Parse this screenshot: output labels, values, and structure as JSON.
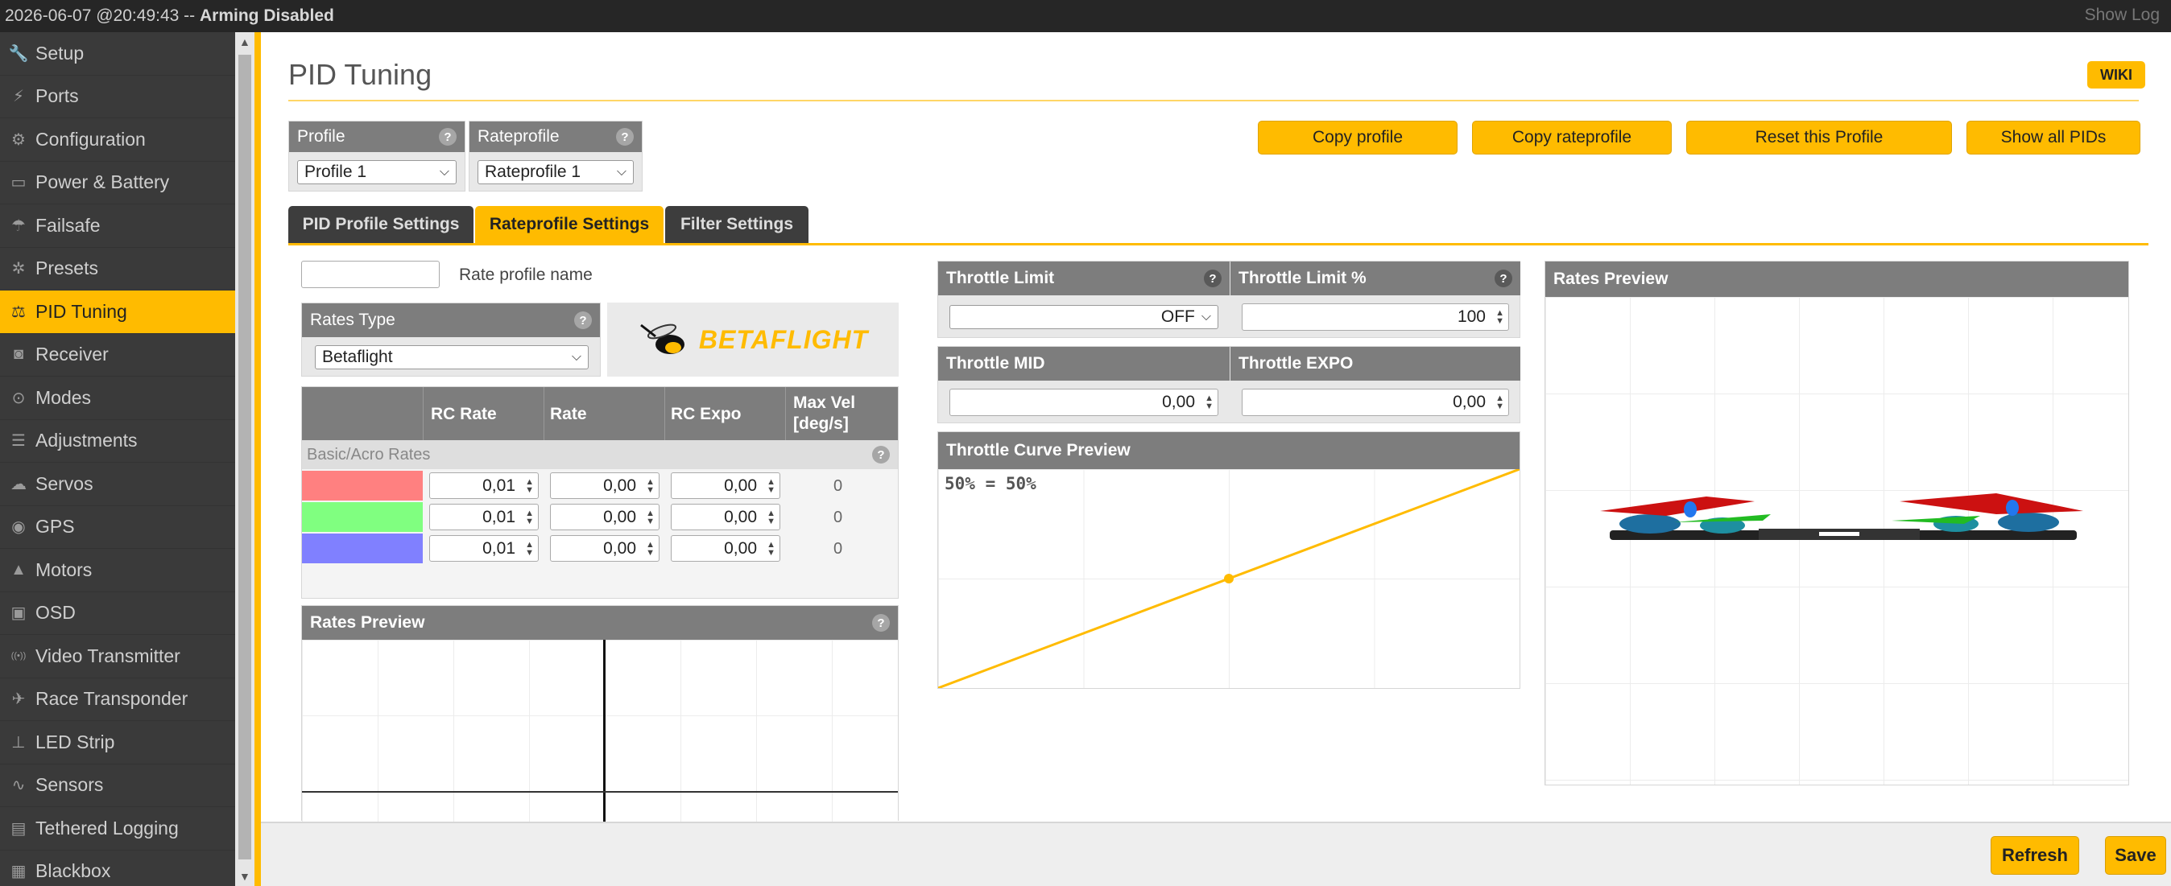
{
  "topbar": {
    "timestamp": "2026-06-07 @20:49:43 --",
    "status": "Arming Disabled",
    "show_log": "Show Log"
  },
  "sidebar": {
    "items": [
      {
        "label": "Setup",
        "icon": "wrench-icon",
        "glyph": "🔧"
      },
      {
        "label": "Ports",
        "icon": "plug-icon",
        "glyph": "⚡"
      },
      {
        "label": "Configuration",
        "icon": "gear-icon",
        "glyph": "⚙"
      },
      {
        "label": "Power & Battery",
        "icon": "battery-icon",
        "glyph": "▭"
      },
      {
        "label": "Failsafe",
        "icon": "parachute-icon",
        "glyph": "☂"
      },
      {
        "label": "Presets",
        "icon": "presets-icon",
        "glyph": "✲"
      },
      {
        "label": "PID Tuning",
        "icon": "pid-tuning-icon",
        "glyph": "⚖"
      },
      {
        "label": "Receiver",
        "icon": "receiver-icon",
        "glyph": "◙"
      },
      {
        "label": "Modes",
        "icon": "toggle-icon",
        "glyph": "⊙"
      },
      {
        "label": "Adjustments",
        "icon": "sliders-icon",
        "glyph": "☰"
      },
      {
        "label": "Servos",
        "icon": "servo-icon",
        "glyph": "☁"
      },
      {
        "label": "GPS",
        "icon": "gps-icon",
        "glyph": "◉"
      },
      {
        "label": "Motors",
        "icon": "motor-icon",
        "glyph": "▲"
      },
      {
        "label": "OSD",
        "icon": "osd-icon",
        "glyph": "▣"
      },
      {
        "label": "Video Transmitter",
        "icon": "antenna-icon",
        "glyph": "((•))"
      },
      {
        "label": "Race Transponder",
        "icon": "transponder-icon",
        "glyph": "✈"
      },
      {
        "label": "LED Strip",
        "icon": "led-icon",
        "glyph": "⊥"
      },
      {
        "label": "Sensors",
        "icon": "sensors-icon",
        "glyph": "∿"
      },
      {
        "label": "Tethered Logging",
        "icon": "log-icon",
        "glyph": "▤"
      },
      {
        "label": "Blackbox",
        "icon": "blackbox-icon",
        "glyph": "▦"
      }
    ]
  },
  "page": {
    "title": "PID Tuning",
    "wiki": "WIKI"
  },
  "profile": {
    "label": "Profile",
    "value": "Profile 1"
  },
  "rateprofile": {
    "label": "Rateprofile",
    "value": "Rateprofile 1"
  },
  "actions": {
    "copy_profile": "Copy profile",
    "copy_rateprofile": "Copy rateprofile",
    "reset_profile": "Reset this Profile",
    "show_all_pids": "Show all PIDs"
  },
  "tabs": [
    "PID Profile Settings",
    "Rateprofile Settings",
    "Filter Settings"
  ],
  "rate_profile_name": {
    "value": "",
    "label": "Rate profile name"
  },
  "rates_type": {
    "label": "Rates Type",
    "value": "Betaflight",
    "logo": "BETAFLIGHT"
  },
  "rates_table": {
    "headers": [
      "RC Rate",
      "Rate",
      "RC Expo",
      "Max Vel",
      "[deg/s]"
    ],
    "section": "Basic/Acro Rates",
    "rows": [
      {
        "color": "#ff8080",
        "rc_rate": "0,01",
        "rate": "0,00",
        "rc_expo": "0,00",
        "max_vel": "0"
      },
      {
        "color": "#80ff80",
        "rc_rate": "0,01",
        "rate": "0,00",
        "rc_expo": "0,00",
        "max_vel": "0"
      },
      {
        "color": "#8080ff",
        "rc_rate": "0,01",
        "rate": "0,00",
        "rc_expo": "0,00",
        "max_vel": "0"
      }
    ]
  },
  "rates_preview_left": {
    "title": "Rates Preview"
  },
  "throttle": {
    "limit_label": "Throttle Limit",
    "limit_value": "OFF",
    "limit_pct_label": "Throttle Limit %",
    "limit_pct_value": "100",
    "mid_label": "Throttle MID",
    "mid_value": "0,00",
    "expo_label": "Throttle EXPO",
    "expo_value": "0,00",
    "curve_title": "Throttle Curve Preview",
    "curve_text": "50% = 50%",
    "accent": "#ffbb00"
  },
  "rates_preview_right": {
    "title": "Rates Preview"
  },
  "footer": {
    "refresh": "Refresh",
    "save": "Save"
  }
}
